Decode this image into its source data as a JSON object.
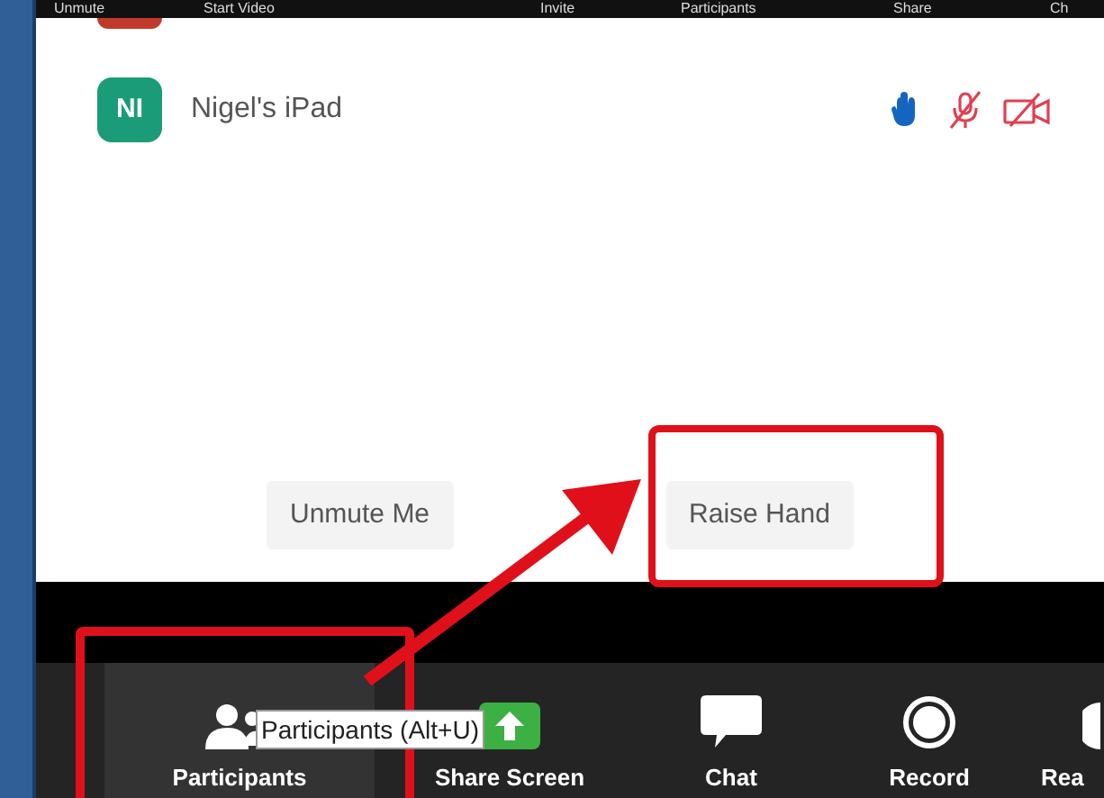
{
  "top_toolbar": [
    "Unmute",
    "Start Video",
    "Invite",
    "Participants",
    "Share",
    "Ch"
  ],
  "participants": [
    {
      "initials": "NI",
      "name": "Nigel's iPad",
      "color": "#1a9c78",
      "hand_raised": true,
      "muted": true,
      "video_off": true
    }
  ],
  "panel_buttons": [
    "Unmute Me",
    "Raise Hand"
  ],
  "toolbar": [
    {
      "label": "Participants",
      "kind": "people"
    },
    {
      "label": "Share Screen",
      "kind": "share"
    },
    {
      "label": "Chat",
      "kind": "chat"
    },
    {
      "label": "Record",
      "kind": "record"
    },
    {
      "label": "Rea",
      "kind": "reactions"
    }
  ],
  "tooltip": "Participants (Alt+U)"
}
